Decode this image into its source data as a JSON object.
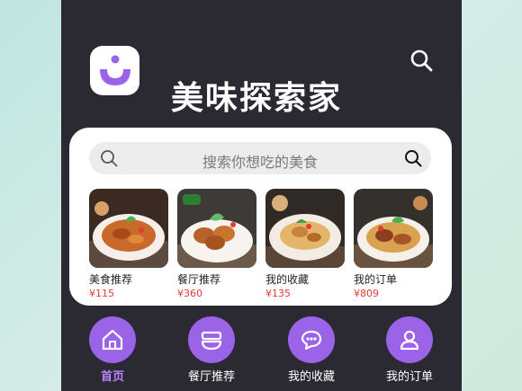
{
  "app": {
    "title": "美味探索家"
  },
  "search": {
    "placeholder": "搜索你想吃的美食"
  },
  "tiles": [
    {
      "label": "美食推荐",
      "price": "¥115"
    },
    {
      "label": "餐厅推荐",
      "price": "¥360"
    },
    {
      "label": "我的收藏",
      "price": "¥135"
    },
    {
      "label": "我的订单",
      "price": "¥809"
    }
  ],
  "nav": [
    {
      "label": "首页",
      "icon": "home-icon",
      "active": true
    },
    {
      "label": "餐厅推荐",
      "icon": "bowl-icon",
      "active": false
    },
    {
      "label": "我的收藏",
      "icon": "chat-bubble-icon",
      "active": false
    },
    {
      "label": "我的订单",
      "icon": "user-icon",
      "active": false
    }
  ],
  "colors": {
    "accent": "#9b63e8",
    "active_label": "#b984ff",
    "price": "#e53935",
    "background": "#2b2a33"
  }
}
